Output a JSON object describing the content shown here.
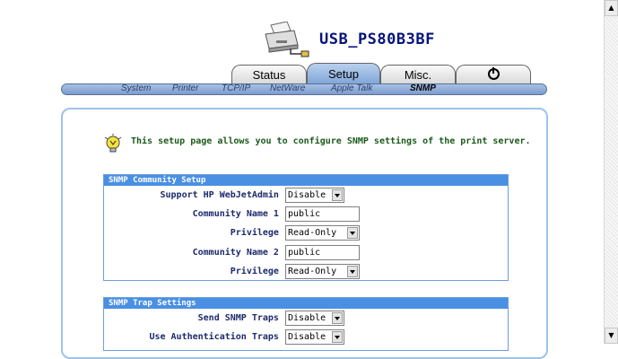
{
  "device": {
    "name": "USB_PS80B3BF"
  },
  "tabs": [
    {
      "label": "Status"
    },
    {
      "label": "Setup"
    },
    {
      "label": "Misc."
    }
  ],
  "subnav": [
    {
      "label": "System"
    },
    {
      "label": "Printer"
    },
    {
      "label": "TCP/IP"
    },
    {
      "label": "NetWare"
    },
    {
      "label": "Apple Talk"
    },
    {
      "label": "SNMP"
    }
  ],
  "info": {
    "text": "This setup page allows you to configure SNMP settings of the print server."
  },
  "community": {
    "title": "SNMP Community Setup",
    "webjet_label": "Support HP WebJetAdmin :",
    "webjet_value": "Disable",
    "name1_label": "Community Name 1 :",
    "name1_value": "public",
    "priv1_label": "Privilege :",
    "priv1_value": "Read-Only",
    "name2_label": "Community Name 2 :",
    "name2_value": "public",
    "priv2_label": "Privilege :",
    "priv2_value": "Read-Only"
  },
  "traps": {
    "title": "SNMP Trap Settings",
    "send_label": "Send SNMP Traps :",
    "send_value": "Disable",
    "auth_label": "Use Authentication Traps :",
    "auth_value": "Disable"
  },
  "colors": {
    "accent": "#4a90e2",
    "title": "#06147a",
    "info_text": "#1a5a1a"
  },
  "icons": {
    "power": "power-icon",
    "printer": "printer-icon",
    "info": "lightbulb-icon"
  }
}
